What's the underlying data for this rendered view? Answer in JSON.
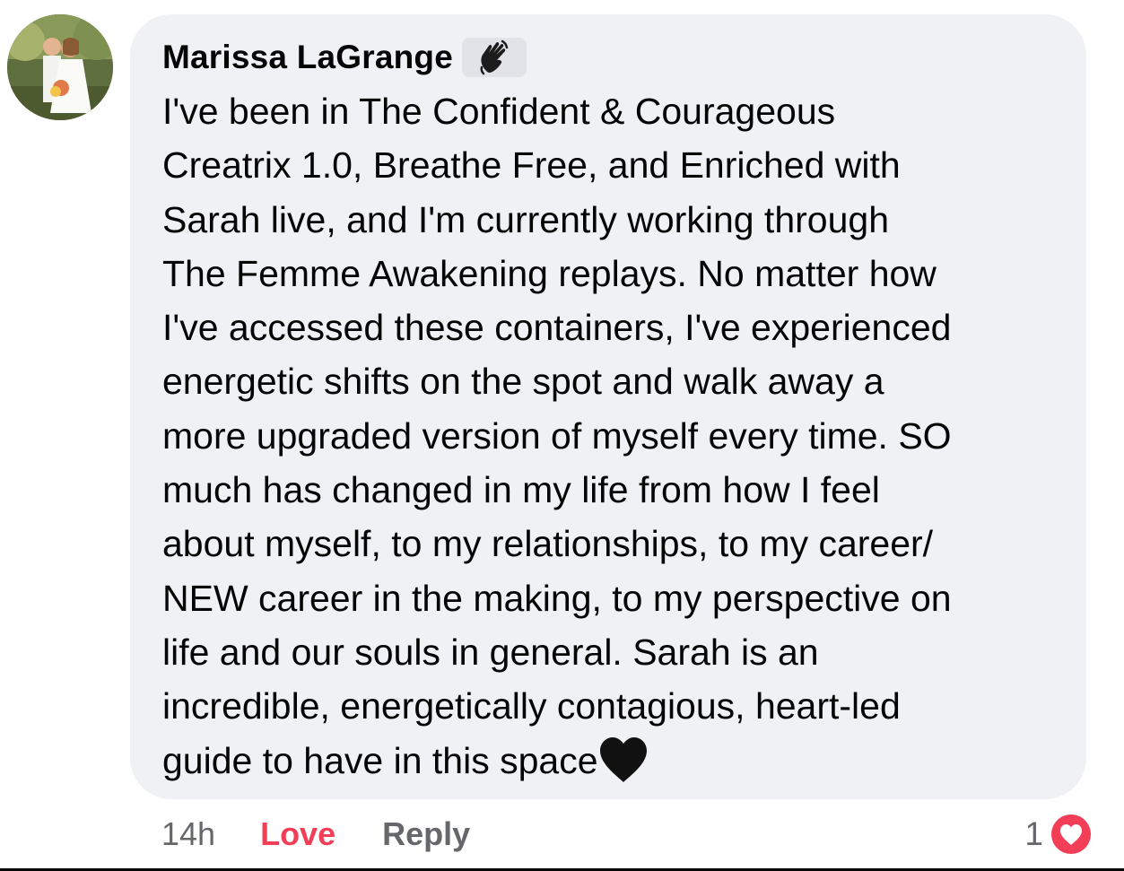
{
  "comment": {
    "author": "Marissa LaGrange",
    "author_badge_icon": "waving-hand-icon",
    "lines": [
      "I've been in The Confident & Courageous",
      "Creatrix 1.0, Breathe Free, and Enriched with",
      "Sarah live, and I'm currently working through",
      "The Femme Awakening replays. No matter how",
      "I've accessed these containers, I've experienced",
      "energetic shifts on the spot and walk away a",
      "more upgraded version of myself every time. SO",
      "much has changed in my life from how I feel",
      "about myself, to my relationships, to my career/",
      "NEW career in the making, to my perspective on",
      "life and our souls in general. Sarah is an",
      "incredible, energetically contagious, heart-led",
      "guide to have in this space"
    ],
    "trailing_emoji": "black-heart-icon",
    "timestamp": "14h",
    "love_label": "Love",
    "reply_label": "Reply",
    "reaction_count": "1",
    "reaction_icon": "love-reaction-icon"
  },
  "colors": {
    "bubble": "#f0f1f5",
    "love": "#f33e58",
    "secondary_text": "#65676b",
    "primary_text": "#050505"
  }
}
